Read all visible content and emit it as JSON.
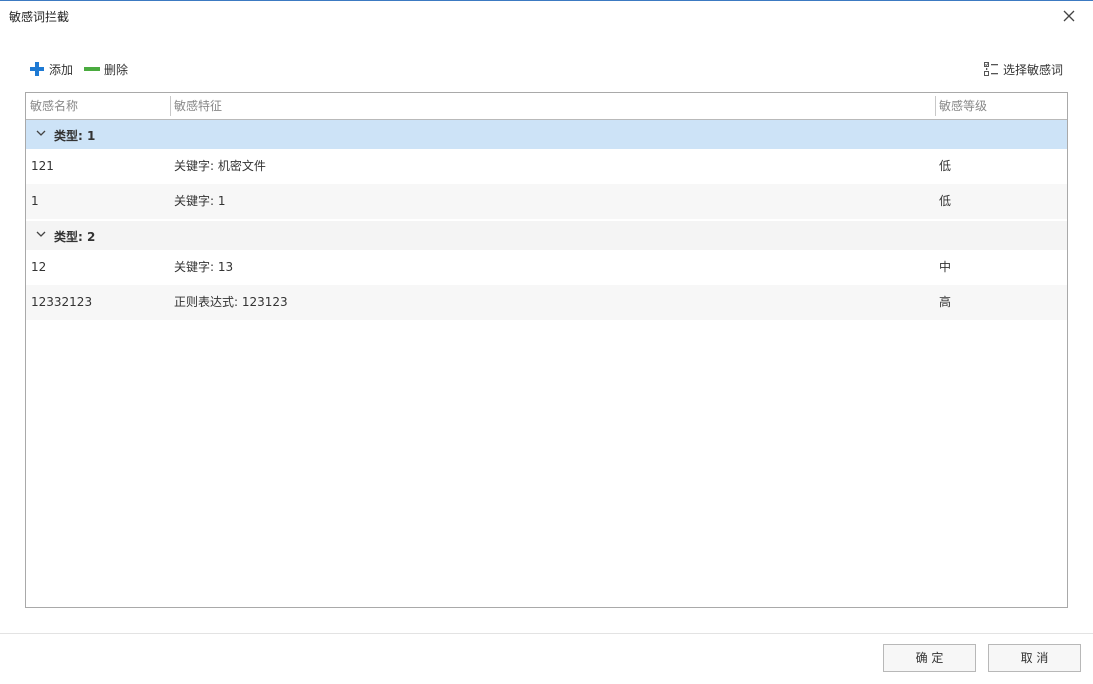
{
  "window": {
    "title": "敏感词拦截"
  },
  "toolbar": {
    "add_label": "添加",
    "delete_label": "删除",
    "select_label": "选择敏感词"
  },
  "grid": {
    "columns": [
      "敏感名称",
      "敏感特征",
      "敏感等级"
    ],
    "groups": [
      {
        "label": "类型: 1",
        "rows": [
          {
            "name": "121",
            "feature": "关键字: 机密文件",
            "level": "低"
          },
          {
            "name": "1",
            "feature": "关键字: 1",
            "level": "低"
          }
        ]
      },
      {
        "label": "类型: 2",
        "rows": [
          {
            "name": "12",
            "feature": "关键字: 13",
            "level": "中"
          },
          {
            "name": "12332123",
            "feature": "正则表达式: 123123",
            "level": "高"
          }
        ]
      }
    ]
  },
  "footer": {
    "ok_label": "确 定",
    "cancel_label": "取 消"
  },
  "colors": {
    "accent": "#3c7ac2",
    "selected_group": "#cde3f7",
    "stripe": "#f7f7f7",
    "add_icon": "#1e7ad4",
    "delete_icon": "#4aab3f"
  }
}
